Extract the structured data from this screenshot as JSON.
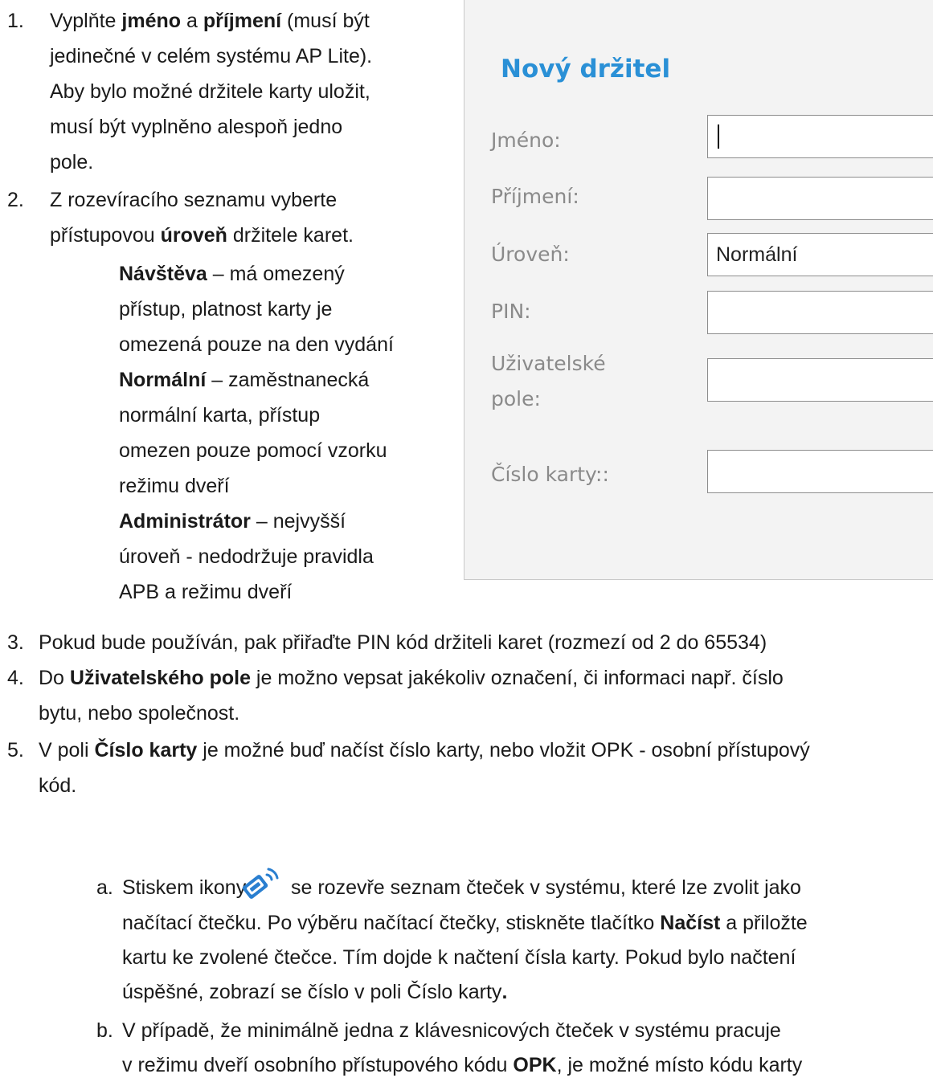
{
  "steps": {
    "s1": {
      "num": "1.",
      "line1": {
        "a": "Vyplňte ",
        "b": "jméno",
        "c": " a ",
        "d": "příjmení",
        "e": " (musí být"
      },
      "line2": "jedinečné v celém systému AP Lite).",
      "line3": "Aby bylo možné držitele karty uložit,",
      "line4": "musí být vyplněno alespoň jedno",
      "line5": "pole."
    },
    "s2": {
      "num": "2.",
      "line1": "Z rozevíracího seznamu vyberte",
      "line2": {
        "a": "přístupovou ",
        "b": "úroveň",
        "c": " držitele karet."
      },
      "levels": {
        "l1": {
          "name": "Návštěva",
          "rest": " – má omezený"
        },
        "l2": "přístup, platnost karty je",
        "l3": "omezená pouze na den vydání",
        "l4": {
          "name": "Normální",
          "rest": " – zaměstnanecká"
        },
        "l5": "normální karta, přístup",
        "l6": "omezen pouze pomocí vzorku",
        "l7": "režimu dveří",
        "l8": {
          "name": "Administrátor",
          "rest": " – nejvyšší"
        },
        "l9": "úroveň - nedodržuje pravidla",
        "l10": "APB a režimu dveří"
      }
    },
    "s3": {
      "num": "3.",
      "line1": "Pokud bude používán, pak přiřaďte PIN kód držiteli karet (rozmezí od 2 do 65534)"
    },
    "s4": {
      "num": "4.",
      "line1": {
        "a": "Do ",
        "b": "Uživatelského pole",
        "c": " je možno vepsat jakékoliv označení, či informaci např. číslo"
      },
      "line2": "bytu, nebo společnost."
    },
    "s5": {
      "num": "5.",
      "line1": {
        "a": "V poli ",
        "b": "Číslo karty",
        "c": " je možné buď načíst číslo karty, nebo vložit OPK - osobní přístupový"
      },
      "line2": "kód.",
      "a": {
        "letter": "a.",
        "line1a": "Stiskem ikony",
        "line1b": "se rozevře seznam čteček v systému, které lze zvolit jako",
        "line2": {
          "a": "načítací čtečku. Po výběru načítací čtečky, stiskněte tlačítko ",
          "b": "Načíst",
          "c": " a přiložte"
        },
        "line3": "kartu ke zvolené čtečce. Tím dojde k načtení čísla karty. Pokud bylo načtení",
        "line4": {
          "a": "úspěšné, zobrazí se číslo v poli Číslo karty",
          "b": "."
        }
      },
      "b": {
        "letter": "b.",
        "line1": "V případě, že minimálně jedna z klávesnicových čteček v systému pracuje",
        "line2": {
          "a": "v režimu dveří osobního přístupového kódu ",
          "b": "OPK",
          "c": ", je možné místo kódu karty"
        }
      }
    }
  },
  "dialog": {
    "title": "Nový držitel",
    "fields": {
      "jmeno": {
        "label": "Jméno:",
        "value": ""
      },
      "prijmeni": {
        "label": "Příjmení:",
        "value": ""
      },
      "uroven": {
        "label": "Úroveň:",
        "value": "Normální"
      },
      "pin": {
        "label": "PIN:",
        "value": ""
      },
      "uzivatelske": {
        "label1": "Uživatelské",
        "label2": "pole:",
        "value": ""
      },
      "cislo_karty": {
        "label": "Číslo karty::",
        "value": ""
      }
    }
  },
  "icons": {
    "reader": "nfc-reader-icon"
  },
  "colors": {
    "title": "#2a90d6",
    "label": "#8a8a8a",
    "icon": "#2a7fd0"
  }
}
